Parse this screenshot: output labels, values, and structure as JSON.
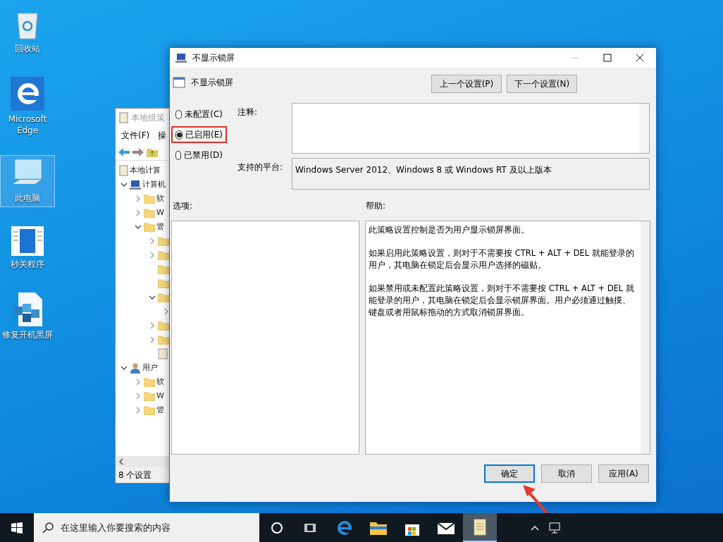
{
  "desktop_icons": [
    {
      "kind": "recycle",
      "label": "回收站",
      "selected": false
    },
    {
      "kind": "edge",
      "label": "Microsoft Edge",
      "selected": false
    },
    {
      "kind": "pc",
      "label": "此电脑",
      "selected": true
    },
    {
      "kind": "app",
      "label": "秒关程序",
      "selected": false
    },
    {
      "kind": "cube",
      "label": "修复开机黑屏",
      "selected": false
    }
  ],
  "background_window": {
    "title": "本地组策",
    "menu": [
      "文件(F)",
      "操"
    ],
    "tree": [
      {
        "kind": "policy",
        "label": "本地计算",
        "children": [
          {
            "kind": "computer",
            "label": "计算机",
            "expanded": true,
            "children": [
              {
                "kind": "folder",
                "label": "软",
                "expanded": false
              },
              {
                "kind": "folder",
                "label": "W",
                "expanded": false
              },
              {
                "kind": "folder",
                "label": "管",
                "expanded": true,
                "children": [
                  {
                    "kind": "folder",
                    "expanded": false
                  },
                  {
                    "kind": "folder",
                    "expanded": false
                  },
                  {
                    "kind": "folder"
                  },
                  {
                    "kind": "folder"
                  },
                  {
                    "kind": "folder",
                    "expanded": true,
                    "children": [
                      {
                        "expanded": false
                      }
                    ]
                  },
                  {
                    "kind": "folder",
                    "expanded": false
                  },
                  {
                    "kind": "folder",
                    "expanded": false
                  },
                  {
                    "kind": "document"
                  }
                ]
              }
            ]
          },
          {
            "kind": "user",
            "label": "用户",
            "expanded": true,
            "children": [
              {
                "kind": "folder",
                "label": "软",
                "expanded": false
              },
              {
                "kind": "folder",
                "label": "W",
                "expanded": false
              },
              {
                "kind": "folder",
                "label": "管",
                "expanded": false
              }
            ]
          }
        ]
      }
    ],
    "status": "8 个设置"
  },
  "dialog": {
    "title": "不显示锁屏",
    "heading": "不显示锁屏",
    "nav_buttons": [
      "上一个设置(P)",
      "下一个设置(N)"
    ],
    "radios": [
      {
        "label": "未配置(C)",
        "selected": false,
        "highlighted": false
      },
      {
        "label": "已启用(E)",
        "selected": true,
        "highlighted": true
      },
      {
        "label": "已禁用(D)",
        "selected": false,
        "highlighted": false
      }
    ],
    "comment_label": "注释:",
    "platform_label": "支持的平台:",
    "platform": "Windows Server 2012、Windows 8 或 Windows RT 及以上版本",
    "options_label": "选项:",
    "help_label": "帮助:",
    "help": [
      "此策略设置控制是否为用户显示锁屏界面。",
      "如果启用此策略设置，则对于不需要按 CTRL + ALT + DEL 就能登录的用户，其电脑在锁定后会显示用户选择的磁贴。",
      "如果禁用或未配置此策略设置，则对于不需要按 CTRL + ALT + DEL 就能登录的用户，其电脑在锁定后会显示锁屏界面。用户必须通过触摸、键盘或者用鼠标拖动的方式取消锁屏界面。"
    ],
    "buttons": [
      {
        "label": "确定",
        "focused": true
      },
      {
        "label": "取消",
        "focused": false
      },
      {
        "label": "应用(A)",
        "focused": false
      }
    ]
  },
  "taskbar": {
    "search_placeholder": "在这里输入你要搜索的内容",
    "apps": [
      {
        "kind": "cortana",
        "active": false
      },
      {
        "kind": "taskview",
        "active": false
      },
      {
        "kind": "edge",
        "active": false
      },
      {
        "kind": "explorer",
        "active": false
      },
      {
        "kind": "store",
        "active": false
      },
      {
        "kind": "mail",
        "active": false
      },
      {
        "kind": "notepad",
        "active": true
      }
    ]
  }
}
